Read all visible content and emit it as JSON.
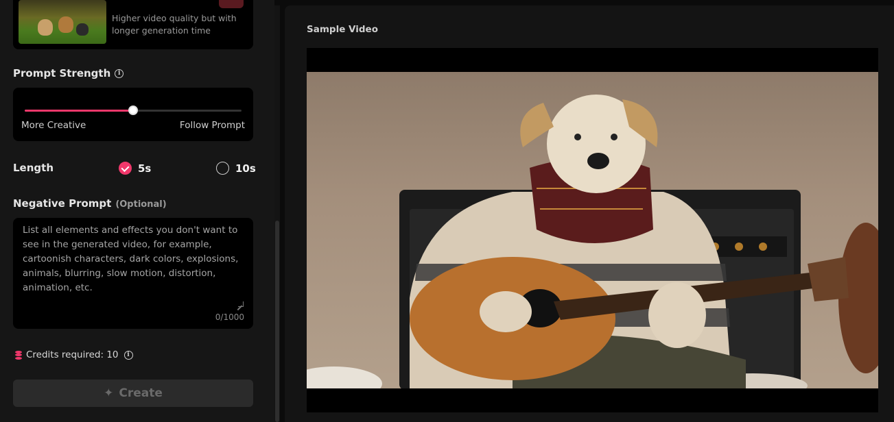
{
  "model_card": {
    "description": "Higher video quality but with longer generation time"
  },
  "prompt_strength": {
    "title": "Prompt Strength",
    "value_fraction": 0.5,
    "left_label": "More Creative",
    "right_label": "Follow Prompt"
  },
  "length": {
    "title": "Length",
    "options": [
      {
        "label": "5s",
        "selected": true
      },
      {
        "label": "10s",
        "selected": false
      }
    ]
  },
  "negative_prompt": {
    "title": "Negative Prompt",
    "optional_tag": "(Optional)",
    "placeholder": "List all elements and effects you don't want to see in the generated video, for example, cartoonish characters, dark colors, explosions, animals, blurring, slow motion, distortion, animation, etc.",
    "char_count": "0/1000"
  },
  "credits": {
    "label": "Credits required: 10"
  },
  "create_button": {
    "label": "Create"
  },
  "sample": {
    "title": "Sample Video"
  },
  "colors": {
    "accent": "#f0386b",
    "panel": "#161616",
    "input_bg": "#000000"
  }
}
